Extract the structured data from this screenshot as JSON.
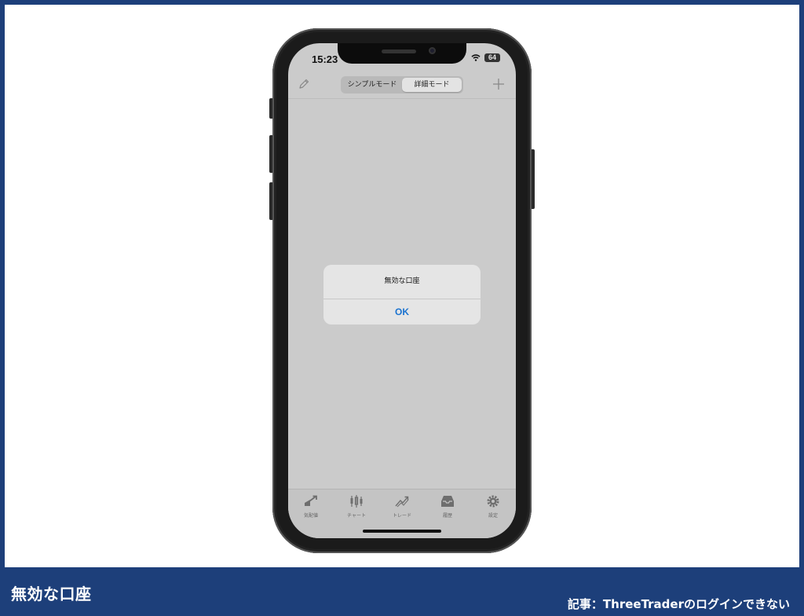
{
  "status_bar": {
    "time": "15:23",
    "battery": "64"
  },
  "nav": {
    "segments": [
      {
        "label": "シンプルモード",
        "active": false
      },
      {
        "label": "詳細モード",
        "active": true
      }
    ]
  },
  "alert": {
    "title": "無効な口座",
    "ok_label": "OK"
  },
  "tab_bar": [
    {
      "icon": "quotes-icon",
      "label": "気配値"
    },
    {
      "icon": "chart-icon",
      "label": "チャート"
    },
    {
      "icon": "trade-icon",
      "label": "トレード"
    },
    {
      "icon": "history-icon",
      "label": "履歴"
    },
    {
      "icon": "settings-icon",
      "label": "設定"
    }
  ],
  "caption": {
    "title": "無効な口座",
    "note": "記事：ThreeTraderのログインできない"
  },
  "colors": {
    "frame": "#1d3f7a",
    "accent": "#1a73d0",
    "screen_dim": "#cbcbcb"
  }
}
